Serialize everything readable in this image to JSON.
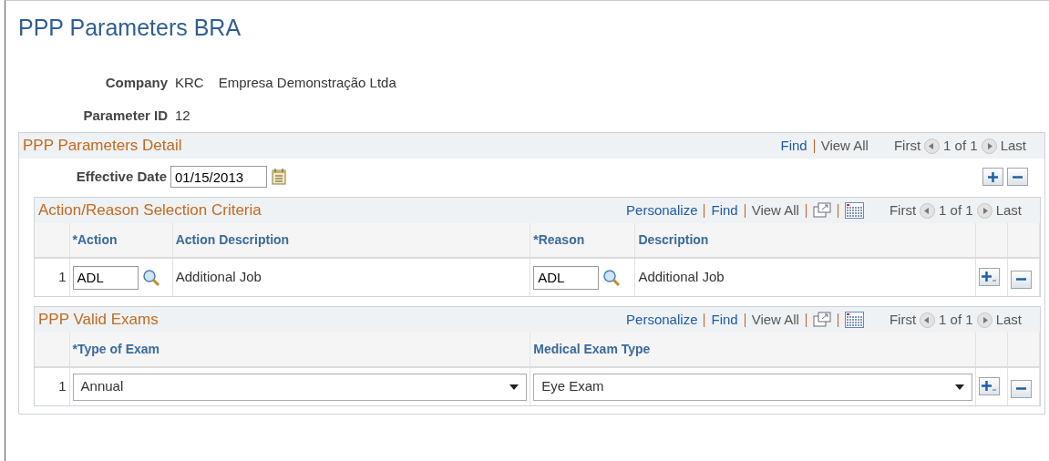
{
  "page_title": "PPP Parameters BRA",
  "fields": [
    {
      "label": "Company",
      "value": "KRC",
      "description": "Empresa Demonstração Ltda"
    },
    {
      "label": "Parameter ID",
      "value": "12"
    }
  ],
  "detail": {
    "title": "PPP Parameters Detail",
    "nav": {
      "links": [
        {
          "text": "Find",
          "disabled": false
        },
        {
          "text": "View All",
          "disabled": true
        }
      ],
      "tools": false,
      "first": "First",
      "count": "1 of 1",
      "last": "Last"
    },
    "effective_date": {
      "label": "Effective Date",
      "value": "01/15/2013"
    },
    "grids": [
      {
        "title": "Action/Reason Selection Criteria",
        "nav": {
          "links": [
            {
              "text": "Personalize",
              "disabled": false
            },
            {
              "text": "Find",
              "disabled": false
            },
            {
              "text": "View All",
              "disabled": true
            }
          ],
          "tools": true,
          "first": "First",
          "count": "1 of 1",
          "last": "Last"
        },
        "columns": [
          "*Action",
          "Action Description",
          "*Reason",
          "Description"
        ],
        "rows": [
          {
            "number": "1",
            "cells": [
              {
                "kind": "lookup",
                "value": "ADL"
              },
              {
                "kind": "text",
                "value": "Additional Job"
              },
              {
                "kind": "lookup",
                "value": "ADL"
              },
              {
                "kind": "text",
                "value": "Additional Job"
              }
            ]
          }
        ]
      },
      {
        "title": "PPP Valid Exams",
        "nav": {
          "links": [
            {
              "text": "Personalize",
              "disabled": false
            },
            {
              "text": "Find",
              "disabled": false
            },
            {
              "text": "View All",
              "disabled": true
            }
          ],
          "tools": true,
          "first": "First",
          "count": "1 of 1",
          "last": "Last"
        },
        "columns": [
          "*Type of Exam",
          "Medical Exam Type"
        ],
        "rows": [
          {
            "number": "1",
            "cells": [
              {
                "kind": "select",
                "value": "Annual"
              },
              {
                "kind": "select",
                "value": "Eye Exam"
              }
            ]
          }
        ]
      }
    ]
  }
}
